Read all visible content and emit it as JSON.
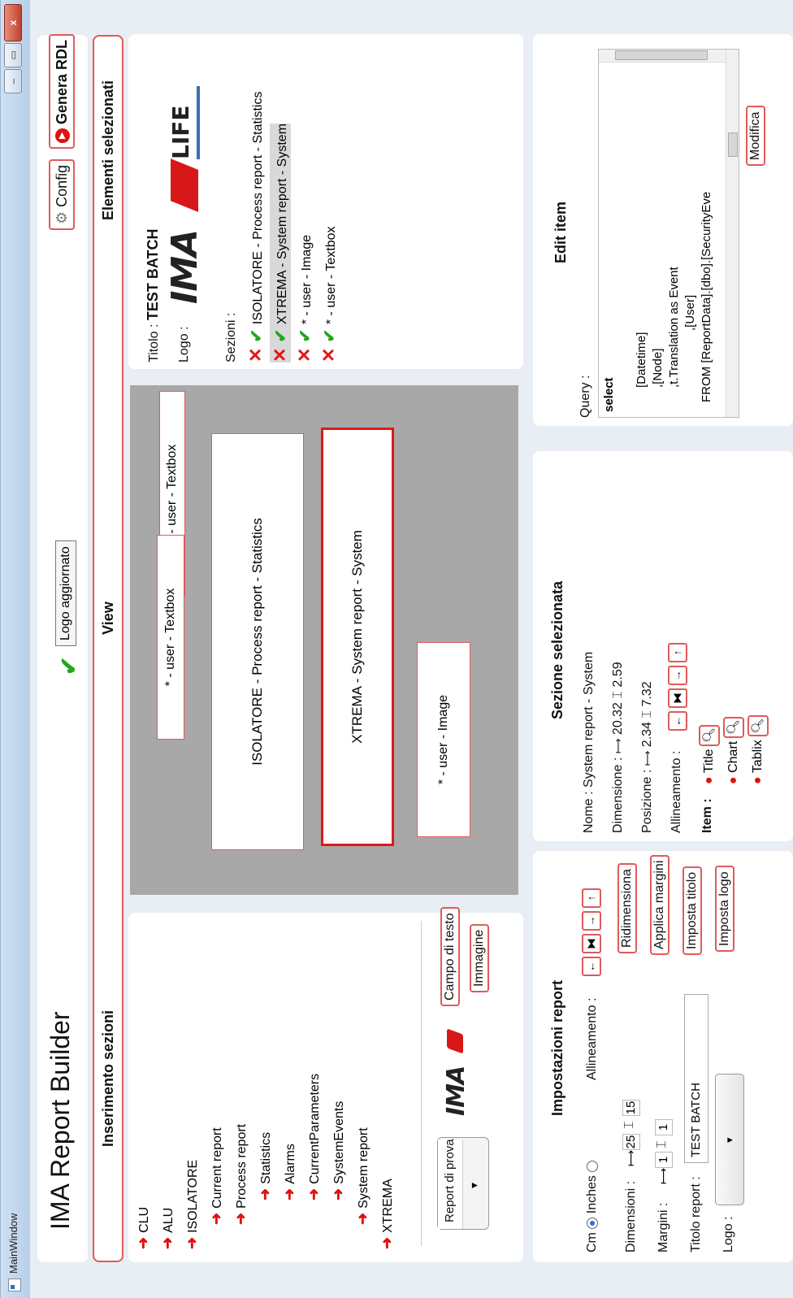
{
  "window": {
    "title": "MainWindow",
    "minimize": "–",
    "maximize": "▭",
    "close": "x"
  },
  "header": {
    "app_title": "IMA Report Builder",
    "logo_status": "Logo aggiornato",
    "config_label": "Config",
    "generate_label": "Genera RDL"
  },
  "tabs": {
    "insert": "Inserimento sezioni",
    "view": "View",
    "selected": "Elementi selezionati"
  },
  "tree": [
    {
      "label": "CLU",
      "level": 0
    },
    {
      "label": "ALU",
      "level": 0
    },
    {
      "label": "ISOLATORE",
      "level": 0
    },
    {
      "label": "Current report",
      "level": 1
    },
    {
      "label": "Process report",
      "level": 1
    },
    {
      "label": "Statistics",
      "level": 2
    },
    {
      "label": "Alarms",
      "level": 2
    },
    {
      "label": "CurrentParameters",
      "level": 2
    },
    {
      "label": "SystemEvents",
      "level": 2
    },
    {
      "label": "System report",
      "level": 1
    },
    {
      "label": "XTREMA",
      "level": 0
    }
  ],
  "insert_panel": {
    "test_report_label": "Report di prova",
    "text_field_label": "Campo di testo",
    "image_label": "Immagine",
    "logo_text": "IMA"
  },
  "canvas": {
    "textbox": "* - user - Textbox",
    "isolatore": "ISOLATORE - Process report - Statistics",
    "xtrema": "XTREMA - System report - System",
    "image": "* - user - Image"
  },
  "selected": {
    "title_label": "Titolo :",
    "title_value": "TEST BATCH",
    "logo_label": "Logo :",
    "logo_text": "IMA",
    "logo_life": "LIFE",
    "sections_label": "Sezioni :",
    "sections": [
      "ISOLATORE - Process report - Statistics",
      "XTREMA - System report - System",
      "* - user - Image",
      "* - user - Textbox"
    ]
  },
  "settings": {
    "header": "Impostazioni report",
    "cm": "Cm",
    "inches": "Inches",
    "alignment_label": "Allineamento :",
    "dimensions_label": "Dimensioni :",
    "dim_w": "25",
    "dim_h": "15",
    "resize_label": "Ridimensiona",
    "margins_label": "Margini :",
    "margin_w": "1",
    "margin_h": "1",
    "apply_margins_label": "Applica margini",
    "title_report_label": "Titolo report :",
    "title_report_value": "TEST BATCH",
    "set_title_label": "Imposta titolo",
    "logo_label": "Logo :",
    "set_logo_label": "Imposta logo"
  },
  "section": {
    "header": "Sezione selezionata",
    "name_label": "Nome :",
    "name_value": "System report - System",
    "dim_label": "Dimensione :",
    "dim_w": "20.32",
    "dim_h": "2.59",
    "pos_label": "Posizione :",
    "pos_x": "2.34",
    "pos_y": "7.32",
    "align_label": "Allineamento :",
    "item_label": "Item :",
    "items": [
      "Title",
      "Chart",
      "Tablix"
    ]
  },
  "edit": {
    "header": "Edit item",
    "query_label": "Query :",
    "query_lines": [
      "select",
      "",
      "[Datetime]",
      ",[Node]",
      ",t.Translation as Event",
      ",[User]",
      "FROM [ReportData].[dbo].[SecurityEve"
    ],
    "modify_label": "Modifica"
  }
}
